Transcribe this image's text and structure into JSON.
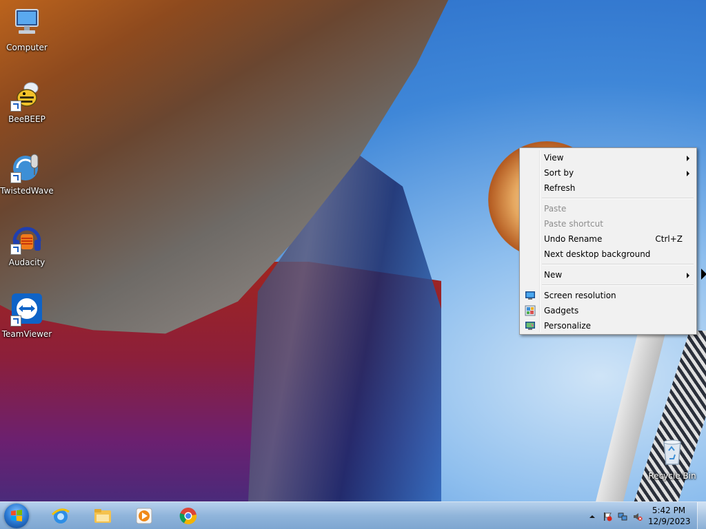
{
  "desktop": {
    "icons": [
      {
        "label": "Computer",
        "icon": "computer-icon"
      },
      {
        "label": "BeeBEEP",
        "icon": "bee-icon"
      },
      {
        "label": "TwistedWave",
        "icon": "microphone-icon"
      },
      {
        "label": "Audacity",
        "icon": "headphones-icon"
      },
      {
        "label": "TeamViewer",
        "icon": "teamviewer-icon"
      },
      {
        "label": "Recycle Bin",
        "icon": "recycle-bin-icon"
      }
    ]
  },
  "context_menu": {
    "items": {
      "view": "View",
      "sort_by": "Sort by",
      "refresh": "Refresh",
      "paste": "Paste",
      "paste_shortcut": "Paste shortcut",
      "undo_rename": "Undo Rename",
      "undo_rename_shortcut": "Ctrl+Z",
      "next_background": "Next desktop background",
      "new": "New",
      "screen_resolution": "Screen resolution",
      "gadgets": "Gadgets",
      "personalize": "Personalize"
    }
  },
  "taskbar": {
    "apps": [
      "internet-explorer-icon",
      "file-explorer-icon",
      "media-player-icon",
      "chrome-icon"
    ],
    "tray": {
      "time": "5:42 PM",
      "date": "12/9/2023"
    }
  },
  "colors": {
    "menu_bg": "#f1f1f1",
    "disabled_text": "#8d8d8d",
    "taskbar": "#9fc0e0"
  }
}
